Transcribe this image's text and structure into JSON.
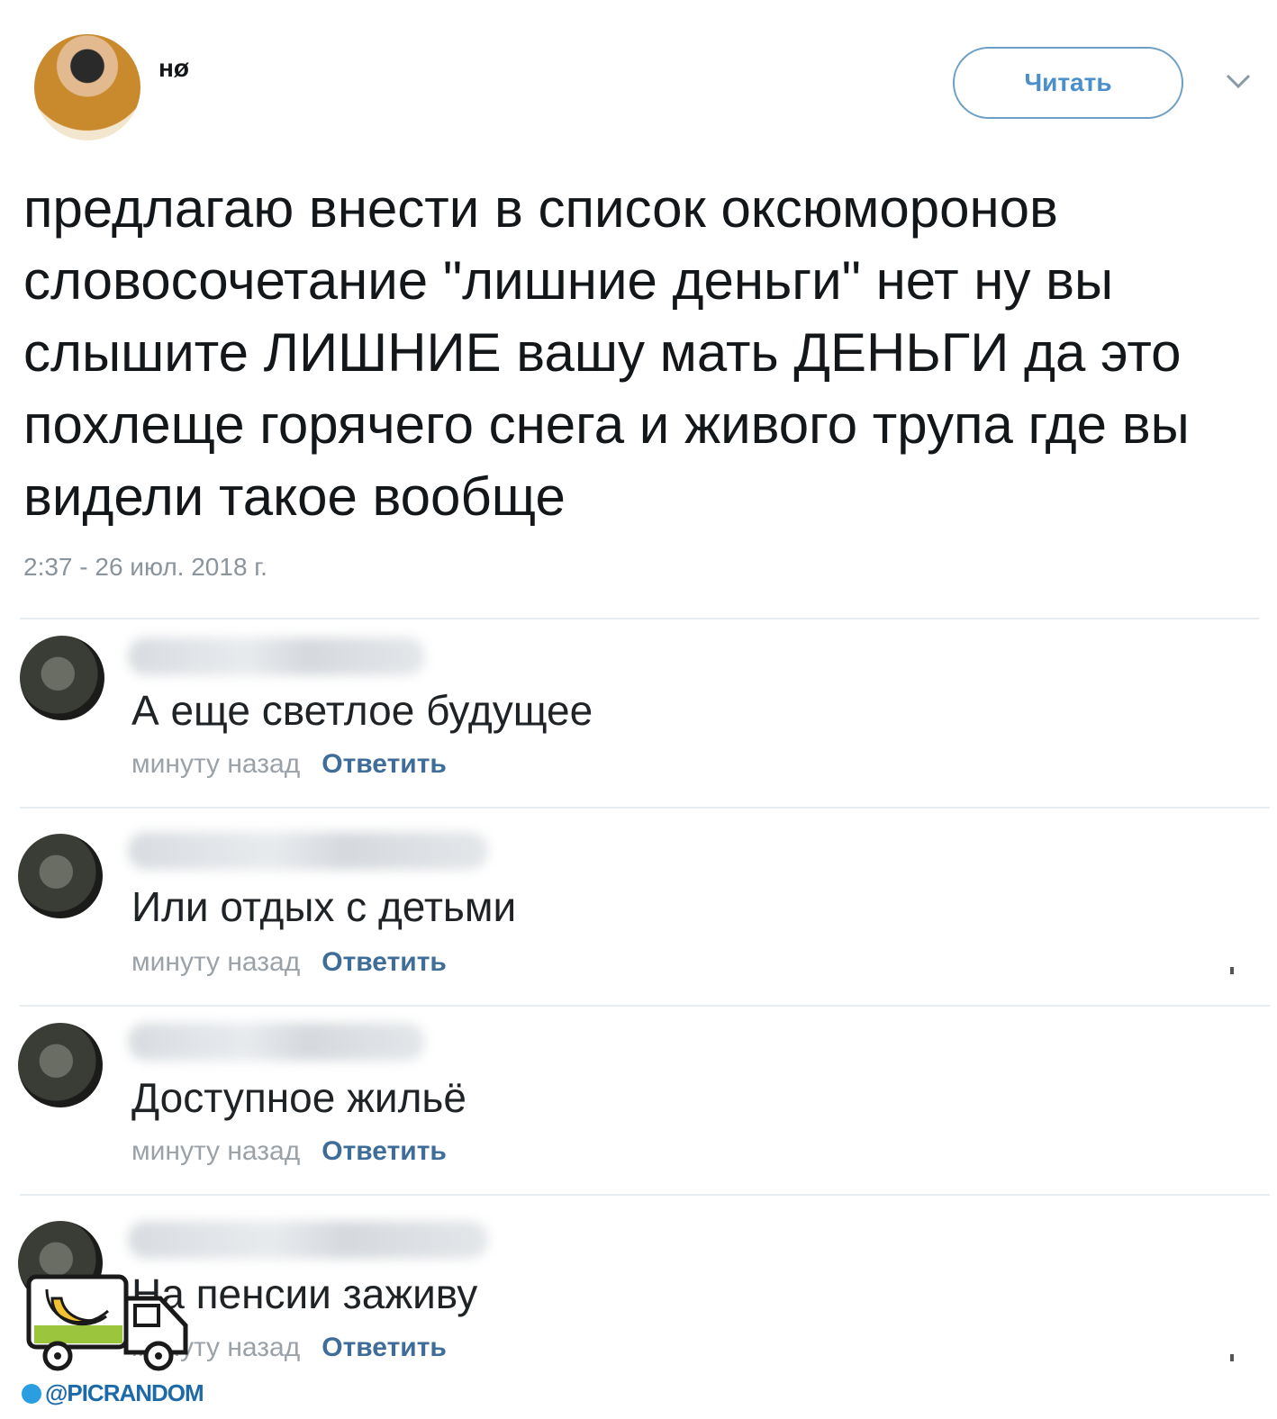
{
  "tweet": {
    "username": "нø",
    "follow_label": "Читать",
    "text": "предлагаю внести в список оксюморонов словосочетание \"лишние деньги\" нет ну вы слышите ЛИШНИЕ вашу мать ДЕНЬГИ да это похлеще горячего снега и живого трупа где вы видели такое вообще",
    "timestamp": "2:37 - 26 июл. 2018 г."
  },
  "comments": [
    {
      "text": "А еще светлое будущее",
      "time": "минуту назад",
      "reply": "Ответить"
    },
    {
      "text": "Или отдых с детьми",
      "time": "минуту назад",
      "reply": "Ответить"
    },
    {
      "text": "Доступное жильё",
      "time": "минуту назад",
      "reply": "Ответить"
    },
    {
      "text": "На пенсии заживу",
      "time": "минуту назад",
      "reply": "Ответить"
    }
  ],
  "watermark": {
    "text": "@PICRANDOM"
  },
  "colors": {
    "follow_border": "#6b9fc6",
    "link": "#3f6d99",
    "meta": "#9aa2a8",
    "divider": "#e6ecf0",
    "watermark_green": "#9bc53d",
    "watermark_blue": "#1c6aa8"
  }
}
